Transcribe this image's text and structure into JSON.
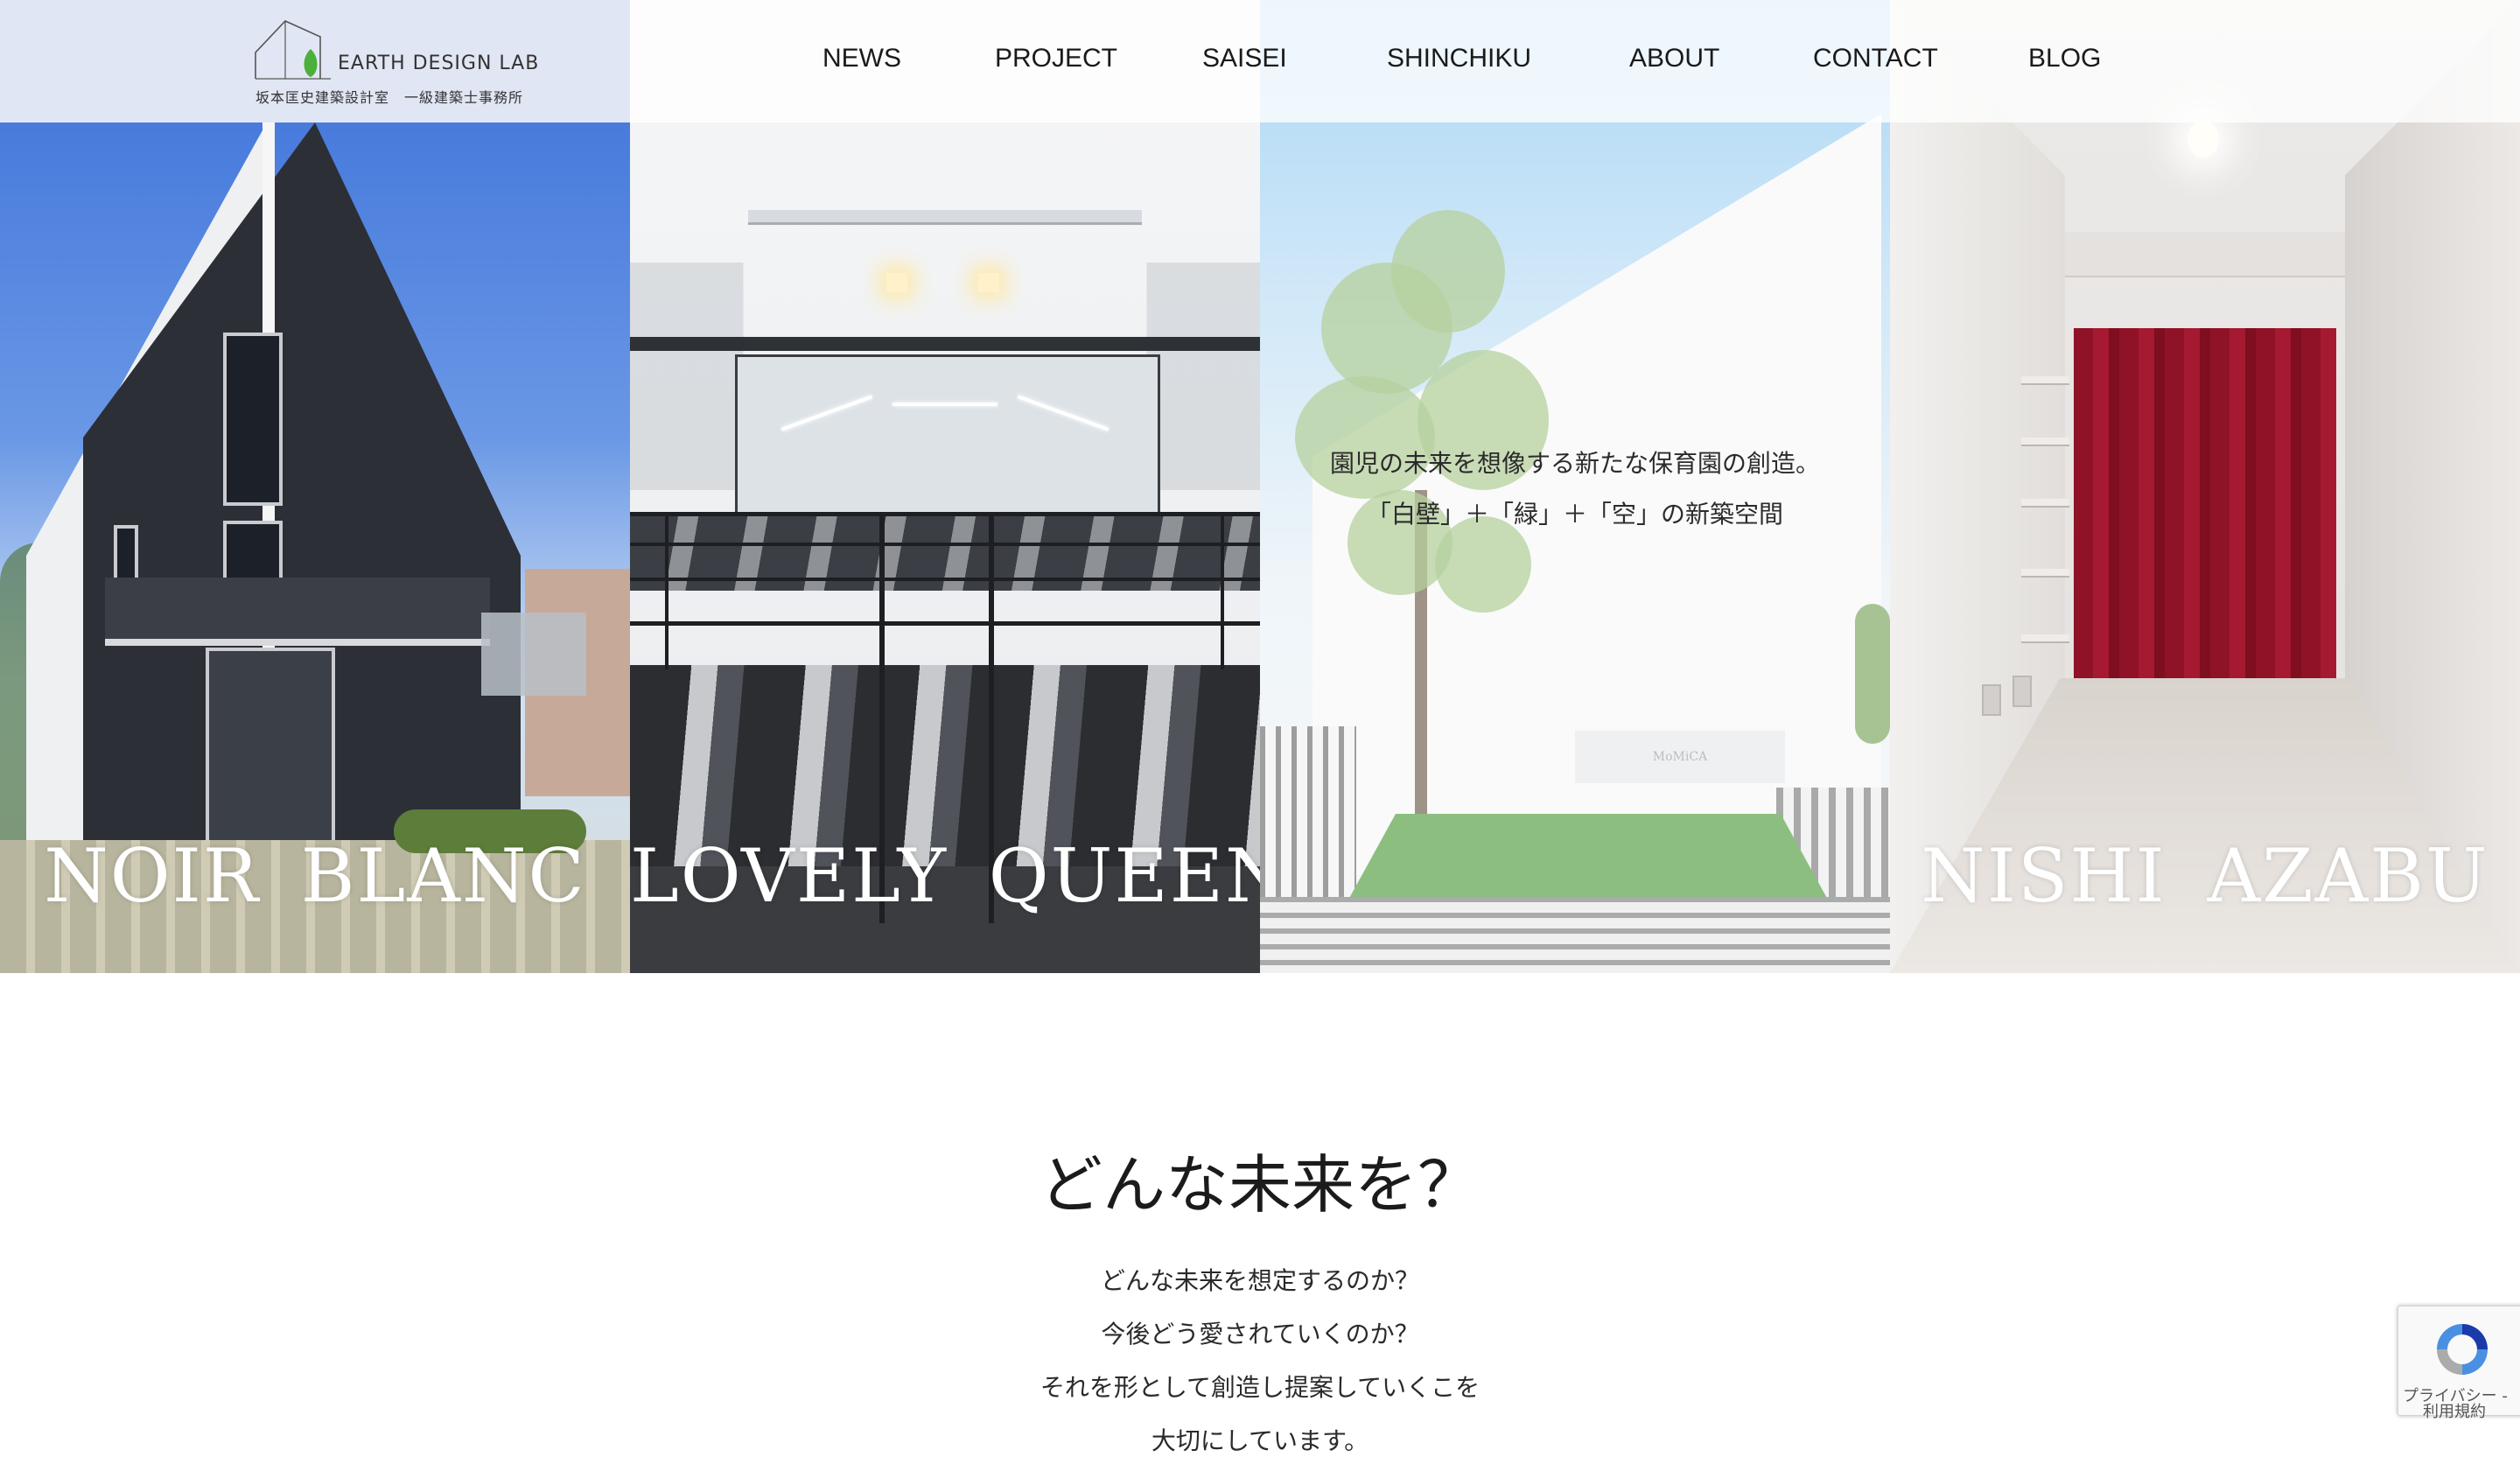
{
  "brand": {
    "logo_main": "EARTH DESIGN LAB",
    "logo_sub": "坂本匡史建築設計室　一級建築士事務所"
  },
  "nav": {
    "items": [
      {
        "label": "NEWS"
      },
      {
        "label": "PROJECT"
      },
      {
        "label": "SAISEI"
      },
      {
        "label": "SHINCHIKU"
      },
      {
        "label": "ABOUT"
      },
      {
        "label": "CONTACT"
      },
      {
        "label": "BLOG"
      }
    ]
  },
  "hero": {
    "panels": [
      {
        "title": "NOIR BLANC"
      },
      {
        "title": "LOVELY QUEEN"
      },
      {
        "title": "",
        "caption_line1": "園児の未来を想像する新たな保育園の創造。",
        "caption_line2": "「白壁」＋「緑」＋「空」の新築空間",
        "sign_text": "MoMiCA"
      },
      {
        "title": "NISHI AZABU"
      }
    ]
  },
  "intro": {
    "heading": "どんな未来を？",
    "lines": [
      "どんな未来を想定するのか？",
      "今後どう愛されていくのか？",
      "それを形として創造し提案していくこを",
      "大切にしています。"
    ]
  },
  "recaptcha": {
    "privacy": "プライバシー -",
    "terms": "利用規約"
  },
  "colors": {
    "logo_bg": "#e1e6f4",
    "logo_leaf": "#4caf3a",
    "nav_text": "#1a1a1a",
    "panel_title": "#ffffff",
    "curtain_red": "#9c1a2e"
  }
}
